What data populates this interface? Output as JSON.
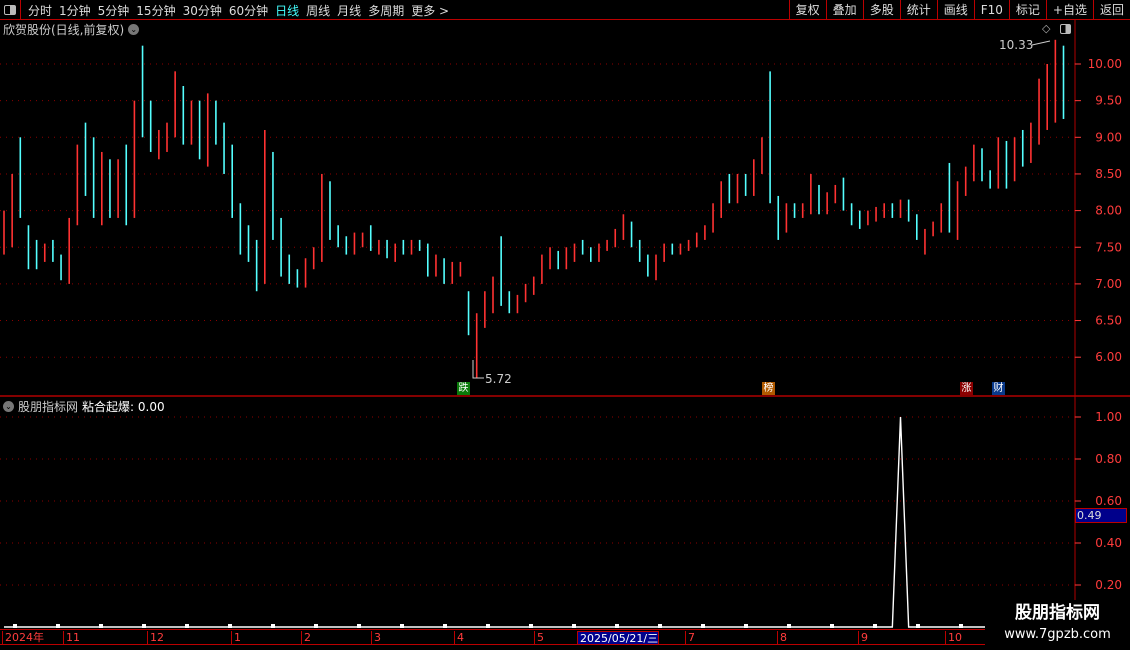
{
  "toolbar": {
    "periods": [
      "分时",
      "1分钟",
      "5分钟",
      "15分钟",
      "30分钟",
      "60分钟",
      "日线",
      "周线",
      "月线",
      "多周期",
      "更多 >"
    ],
    "active_period": "日线",
    "actions": [
      "复权",
      "叠加",
      "多股",
      "统计",
      "画线",
      "F10",
      "标记",
      "+自选",
      "返回"
    ]
  },
  "main_title": "欣贺股份(日线,前复权)",
  "indicator_title": {
    "source": "股朋指标网",
    "name": "粘合起爆: 0.00"
  },
  "markers": [
    {
      "text": "跌",
      "color": "#0a7a0a"
    },
    {
      "text": "榜",
      "color": "#b05a00"
    },
    {
      "text": "涨",
      "color": "#8b0000"
    },
    {
      "text": "财",
      "color": "#0a3a8b"
    }
  ],
  "annotations": {
    "high": "10.33",
    "low": "5.72"
  },
  "indicator_current": "0.49",
  "date_axis": [
    "2024年",
    "11",
    "12",
    "1",
    "2",
    "3",
    "4",
    "5",
    "2025/05/21/三",
    "7",
    "8",
    "9",
    "10"
  ],
  "watermark": {
    "line1": "股朋指标网",
    "line2": "www.7gpzb.com"
  },
  "colors": {
    "up": "#ff3232",
    "down": "#54ffff",
    "flat": "#ffffff",
    "axis": "#ff3c3c",
    "border": "#b00000",
    "grid": "#8b0000"
  },
  "chart_data": [
    {
      "type": "candlestick",
      "title": "欣贺股份(日线,前复权)",
      "y_ticks": [
        "6.00",
        "6.50",
        "7.00",
        "7.50",
        "8.00",
        "8.50",
        "9.00",
        "9.50",
        "10.00"
      ],
      "ylim": [
        5.6,
        10.4
      ],
      "grid": true,
      "ohlc": [
        [
          7.6,
          8.0,
          7.4,
          7.8
        ],
        [
          7.8,
          8.5,
          7.5,
          8.2
        ],
        [
          8.2,
          9.0,
          7.9,
          8.0
        ],
        [
          7.6,
          7.8,
          7.2,
          7.4
        ],
        [
          7.4,
          7.6,
          7.2,
          7.3
        ],
        [
          7.3,
          7.55,
          7.3,
          7.5
        ],
        [
          7.5,
          7.6,
          7.3,
          7.35
        ],
        [
          7.3,
          7.4,
          7.05,
          7.1
        ],
        [
          7.1,
          7.9,
          7.0,
          7.8
        ],
        [
          7.9,
          8.9,
          7.8,
          8.7
        ],
        [
          8.7,
          9.2,
          8.2,
          8.4
        ],
        [
          8.4,
          9.0,
          7.9,
          8.0
        ],
        [
          8.0,
          8.8,
          7.8,
          8.6
        ],
        [
          8.6,
          8.7,
          7.9,
          8.0
        ],
        [
          8.0,
          8.7,
          7.9,
          8.6
        ],
        [
          8.6,
          8.9,
          7.8,
          7.9
        ],
        [
          8.0,
          9.5,
          7.9,
          9.3
        ],
        [
          9.3,
          10.25,
          9.0,
          9.1
        ],
        [
          9.1,
          9.5,
          8.8,
          8.9
        ],
        [
          8.9,
          9.1,
          8.7,
          9.0
        ],
        [
          9.0,
          9.2,
          8.8,
          9.1
        ],
        [
          9.1,
          9.9,
          9.0,
          9.7
        ],
        [
          9.7,
          9.7,
          8.9,
          9.0
        ],
        [
          9.0,
          9.5,
          8.9,
          9.3
        ],
        [
          9.3,
          9.5,
          8.7,
          8.8
        ],
        [
          8.8,
          9.6,
          8.6,
          9.4
        ],
        [
          9.4,
          9.5,
          8.9,
          9.0
        ],
        [
          9.0,
          9.2,
          8.5,
          8.6
        ],
        [
          8.6,
          8.9,
          7.9,
          8.0
        ],
        [
          8.0,
          8.1,
          7.4,
          7.5
        ],
        [
          7.5,
          7.8,
          7.3,
          7.4
        ],
        [
          7.4,
          7.6,
          6.9,
          7.0
        ],
        [
          7.0,
          9.1,
          7.0,
          8.6
        ],
        [
          8.6,
          8.8,
          7.6,
          7.7
        ],
        [
          7.7,
          7.9,
          7.1,
          7.2
        ],
        [
          7.2,
          7.4,
          7.0,
          7.1
        ],
        [
          7.1,
          7.2,
          6.95,
          7.0
        ],
        [
          7.0,
          7.35,
          6.95,
          7.3
        ],
        [
          7.3,
          7.5,
          7.2,
          7.4
        ],
        [
          7.4,
          8.5,
          7.3,
          8.4
        ],
        [
          8.3,
          8.4,
          7.6,
          7.7
        ],
        [
          7.7,
          7.8,
          7.5,
          7.6
        ],
        [
          7.6,
          7.65,
          7.4,
          7.45
        ],
        [
          7.45,
          7.7,
          7.4,
          7.6
        ],
        [
          7.6,
          7.7,
          7.5,
          7.65
        ],
        [
          7.65,
          7.8,
          7.45,
          7.5
        ],
        [
          7.5,
          7.6,
          7.4,
          7.55
        ],
        [
          7.55,
          7.6,
          7.35,
          7.4
        ],
        [
          7.4,
          7.55,
          7.3,
          7.5
        ],
        [
          7.5,
          7.6,
          7.4,
          7.45
        ],
        [
          7.45,
          7.6,
          7.4,
          7.58
        ],
        [
          7.58,
          7.6,
          7.45,
          7.5
        ],
        [
          7.5,
          7.55,
          7.1,
          7.2
        ],
        [
          7.2,
          7.4,
          7.1,
          7.3
        ],
        [
          7.3,
          7.35,
          7.0,
          7.05
        ],
        [
          7.05,
          7.3,
          7.0,
          7.2
        ],
        [
          7.2,
          7.3,
          7.1,
          7.25
        ],
        [
          6.9,
          6.9,
          6.3,
          6.4
        ],
        [
          6.3,
          6.6,
          5.72,
          6.5
        ],
        [
          6.5,
          6.9,
          6.4,
          6.8
        ],
        [
          6.8,
          7.1,
          6.6,
          7.0
        ],
        [
          7.0,
          7.65,
          6.7,
          6.8
        ],
        [
          6.8,
          6.9,
          6.6,
          6.7
        ],
        [
          6.7,
          6.85,
          6.6,
          6.8
        ],
        [
          6.8,
          7.0,
          6.75,
          6.95
        ],
        [
          6.95,
          7.1,
          6.85,
          7.05
        ],
        [
          7.05,
          7.4,
          7.0,
          7.3
        ],
        [
          7.3,
          7.5,
          7.2,
          7.4
        ],
        [
          7.4,
          7.45,
          7.2,
          7.25
        ],
        [
          7.25,
          7.5,
          7.2,
          7.4
        ],
        [
          7.4,
          7.55,
          7.3,
          7.5
        ],
        [
          7.5,
          7.6,
          7.4,
          7.45
        ],
        [
          7.45,
          7.5,
          7.3,
          7.35
        ],
        [
          7.35,
          7.55,
          7.3,
          7.5
        ],
        [
          7.5,
          7.6,
          7.45,
          7.55
        ],
        [
          7.55,
          7.75,
          7.5,
          7.7
        ],
        [
          7.7,
          7.95,
          7.6,
          7.8
        ],
        [
          7.8,
          7.85,
          7.5,
          7.55
        ],
        [
          7.55,
          7.6,
          7.3,
          7.35
        ],
        [
          7.35,
          7.4,
          7.1,
          7.15
        ],
        [
          7.15,
          7.4,
          7.05,
          7.35
        ],
        [
          7.35,
          7.55,
          7.3,
          7.5
        ],
        [
          7.5,
          7.55,
          7.4,
          7.45
        ],
        [
          7.45,
          7.55,
          7.4,
          7.5
        ],
        [
          7.5,
          7.6,
          7.45,
          7.55
        ],
        [
          7.55,
          7.7,
          7.5,
          7.65
        ],
        [
          7.65,
          7.8,
          7.6,
          7.75
        ],
        [
          7.75,
          8.1,
          7.7,
          8.0
        ],
        [
          8.0,
          8.4,
          7.9,
          8.3
        ],
        [
          8.3,
          8.5,
          8.1,
          8.2
        ],
        [
          8.2,
          8.5,
          8.1,
          8.4
        ],
        [
          8.4,
          8.5,
          8.2,
          8.3
        ],
        [
          8.3,
          8.7,
          8.2,
          8.6
        ],
        [
          8.6,
          9.0,
          8.5,
          8.9
        ],
        [
          8.9,
          9.9,
          8.1,
          8.2
        ],
        [
          8.2,
          8.2,
          7.6,
          7.7
        ],
        [
          7.7,
          8.1,
          7.7,
          8.0
        ],
        [
          8.0,
          8.1,
          7.9,
          7.95
        ],
        [
          7.95,
          8.1,
          7.9,
          8.05
        ],
        [
          8.05,
          8.5,
          7.95,
          8.3
        ],
        [
          8.3,
          8.35,
          7.95,
          8.0
        ],
        [
          8.0,
          8.25,
          7.95,
          8.2
        ],
        [
          8.2,
          8.35,
          8.1,
          8.3
        ],
        [
          8.3,
          8.45,
          8.0,
          8.05
        ],
        [
          8.05,
          8.1,
          7.8,
          7.85
        ],
        [
          7.85,
          8.0,
          7.75,
          7.8
        ],
        [
          7.8,
          8.0,
          7.8,
          7.95
        ],
        [
          7.95,
          8.05,
          7.85,
          8.0
        ],
        [
          8.0,
          8.1,
          7.9,
          8.05
        ],
        [
          8.05,
          8.1,
          7.9,
          7.95
        ],
        [
          7.95,
          8.15,
          7.9,
          8.1
        ],
        [
          8.1,
          8.15,
          7.85,
          7.9
        ],
        [
          7.9,
          7.95,
          7.6,
          7.65
        ],
        [
          7.65,
          7.75,
          7.4,
          7.7
        ],
        [
          7.7,
          7.85,
          7.65,
          7.8
        ],
        [
          7.8,
          8.1,
          7.7,
          8.05
        ],
        [
          8.6,
          8.65,
          7.7,
          7.75
        ],
        [
          7.6,
          8.4,
          7.6,
          8.3
        ],
        [
          8.3,
          8.6,
          8.2,
          8.5
        ],
        [
          8.5,
          8.9,
          8.4,
          8.8
        ],
        [
          8.8,
          8.85,
          8.4,
          8.45
        ],
        [
          8.45,
          8.55,
          8.3,
          8.35
        ],
        [
          8.35,
          9.0,
          8.3,
          8.9
        ],
        [
          8.9,
          8.95,
          8.3,
          8.4
        ],
        [
          8.4,
          9.0,
          8.4,
          8.8
        ],
        [
          8.8,
          9.1,
          8.6,
          8.7
        ],
        [
          8.7,
          9.2,
          8.65,
          9.1
        ],
        [
          9.1,
          9.8,
          8.9,
          9.6
        ],
        [
          9.5,
          10.0,
          9.1,
          9.8
        ],
        [
          9.6,
          10.33,
          9.2,
          10.1
        ],
        [
          10.1,
          10.25,
          9.25,
          9.3
        ]
      ]
    },
    {
      "type": "line",
      "title": "粘合起爆",
      "y_ticks": [
        "0.20",
        "0.40",
        "0.60",
        "0.80",
        "1.00"
      ],
      "ylim": [
        0,
        1.05
      ],
      "values": [
        0,
        0,
        0,
        0,
        0,
        0,
        0,
        0,
        0,
        0,
        0,
        0,
        0,
        0,
        0,
        0,
        0,
        0,
        0,
        0,
        0,
        0,
        0,
        0,
        0,
        0,
        0,
        0,
        0,
        0,
        0,
        0,
        0,
        0,
        0,
        0,
        0,
        0,
        0,
        0,
        0,
        0,
        0,
        0,
        0,
        0,
        0,
        0,
        0,
        0,
        0,
        0,
        0,
        0,
        0,
        0,
        0,
        0,
        0,
        0,
        0,
        0,
        0,
        0,
        0,
        0,
        0,
        0,
        0,
        0,
        0,
        0,
        0,
        0,
        0,
        0,
        0,
        0,
        0,
        0,
        0,
        0,
        0,
        0,
        0,
        0,
        0,
        0,
        0,
        0,
        0,
        0,
        0,
        0,
        0,
        0,
        0,
        0,
        0,
        0,
        0,
        0,
        0,
        0,
        0,
        0,
        0,
        0,
        0,
        0,
        1,
        0,
        0,
        0,
        0,
        0,
        0,
        0,
        0,
        0,
        0,
        0,
        0,
        0,
        0,
        0,
        0,
        0,
        0,
        0,
        0
      ]
    }
  ]
}
